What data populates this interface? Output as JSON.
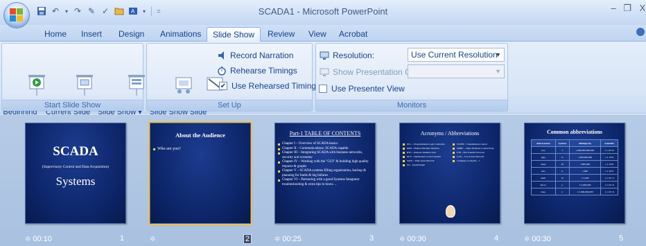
{
  "window": {
    "title": "SCADA1 - Microsoft PowerPoint",
    "controls": {
      "minimize": "–",
      "restore": "❐",
      "close": "X"
    }
  },
  "tabs": [
    {
      "label": "Home"
    },
    {
      "label": "Insert"
    },
    {
      "label": "Design"
    },
    {
      "label": "Animations"
    },
    {
      "label": "Slide Show",
      "active": true
    },
    {
      "label": "Review"
    },
    {
      "label": "View"
    },
    {
      "label": "Acrobat"
    }
  ],
  "ribbon": {
    "start_group": {
      "label": "Start Slide Show",
      "from_beginning": "From\nBeginning",
      "from_current": "From\nCurrent Slide",
      "custom": "Custom\nSlide Show ▾"
    },
    "setup_group": {
      "label": "Set Up",
      "setup_slide_show": "Set Up\nSlide Show",
      "hide_slide": "Hide\nSlide",
      "record_narration": "Record Narration",
      "rehearse_timings": "Rehearse Timings",
      "use_rehearsed_timings": "Use Rehearsed Timings",
      "use_rehearsed_checked": true
    },
    "monitors_group": {
      "label": "Monitors",
      "resolution_label": "Resolution:",
      "resolution_value": "Use Current Resolution",
      "show_on_label": "Show Presentation On:",
      "show_on_value": "",
      "presenter_view": "Use Presenter View",
      "presenter_view_checked": false
    }
  },
  "slides": [
    {
      "number": "1",
      "time": "00:10",
      "title": "SCADA",
      "subtitle": "(Supervisory Control and Data Acquisition)",
      "title2": "Systems"
    },
    {
      "number": "2",
      "time": "",
      "title": "About the Audience",
      "bullets": [
        "Who are you?"
      ]
    },
    {
      "number": "3",
      "time": "00:25",
      "title": "Part-1 TABLE OF CONTENTS",
      "bullets": [
        "Chapter I – Overview of SCADA basics",
        "Chapter II – Communications: SCADA capable",
        "Chapter III – Integrating SCADA with business networks, security and economy",
        "Chapter IV – Working with the \"GUI\" & building high quality impacts & graphs",
        "Chapter V – SCADA systems filling organization, backup & planning for faults & big failures",
        "Chapter VI – Partnering with a good Systems Integrator troubleshooting & extra tips to know…"
      ]
    },
    {
      "number": "4",
      "time": "00:30",
      "title": "Acronyms / Abbreviations",
      "bullets": [
        "PLC – Programmable Logic Controller",
        "HMI – Human Machine Interface",
        "RTU – Remote Terminal Unit",
        "DCS – Distributed Control System",
        "TCP/IP – Transmission Control",
        "ODBC – Open Database Connectivity",
        "FTP – File Transfer Protocol",
        "LAN – Local Area Network",
        "WAN – Wide Area Network",
        "I/O – Input/Output",
        "Company acronyms…?"
      ]
    },
    {
      "number": "5",
      "time": "00:30",
      "title": "Common abbreviations",
      "table_header": [
        "Abbreviation",
        "Symbol",
        "Multiply By",
        "Scientific"
      ],
      "table_rows": [
        [
          "tera",
          "T",
          "1,000,000,000,000",
          "1 x 10^12"
        ],
        [
          "giga",
          "G",
          "1,000,000,000",
          "1 x 10^9"
        ],
        [
          "mega",
          "M",
          "1,000,000",
          "1 x 10^6"
        ],
        [
          "kilo",
          "k",
          "1,000",
          "1 x 10^3"
        ],
        [
          "milli",
          "m",
          "1/1,000",
          "1 x 10^-3"
        ],
        [
          "micro",
          "µ",
          "1/1,000,000",
          "1 x 10^-6"
        ],
        [
          "nano",
          "n",
          "1/1,000,000,000",
          "1 x 10^-9"
        ]
      ]
    }
  ]
}
